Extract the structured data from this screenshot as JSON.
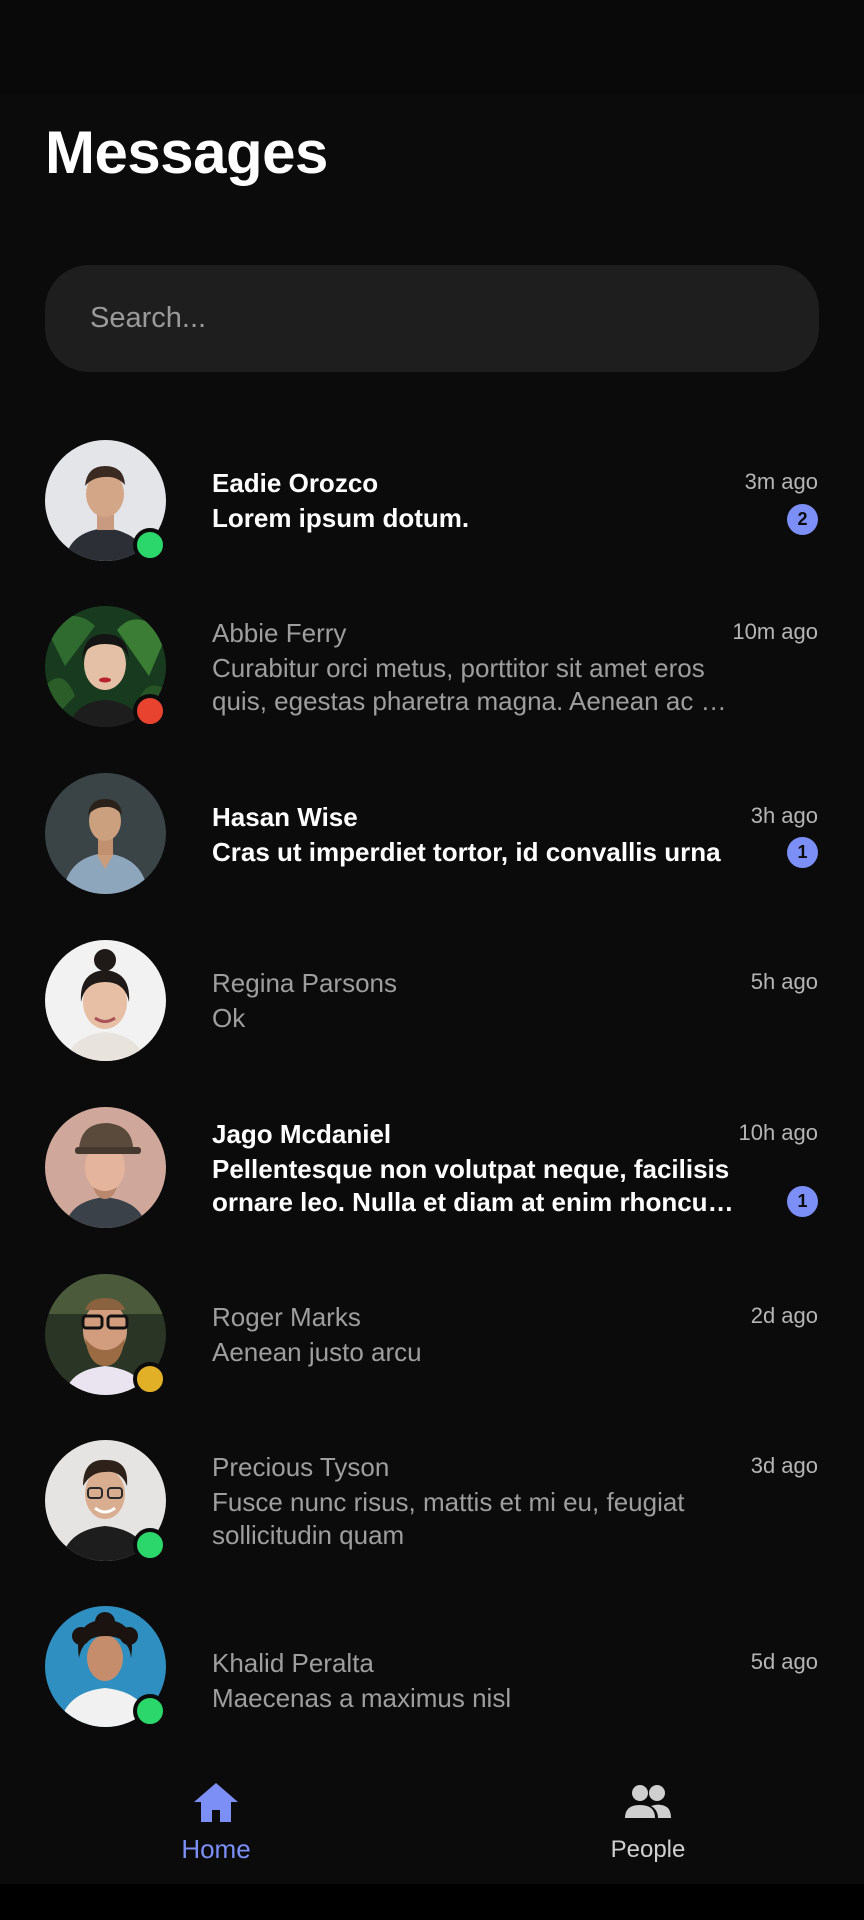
{
  "header": {
    "title": "Messages"
  },
  "search": {
    "placeholder": "Search..."
  },
  "colors": {
    "accent": "#7b8ff7",
    "online": "#2bd66b",
    "busy": "#e8432f",
    "away": "#e2b027",
    "background": "#0b0b0b"
  },
  "conversations": [
    {
      "name": "Eadie Orozco",
      "message": "Lorem ipsum dotum.",
      "time": "3m ago",
      "unread_count": "2",
      "status": "online"
    },
    {
      "name": "Abbie Ferry",
      "message": "Curabitur orci metus, porttitor sit amet eros quis, egestas pharetra magna. Aenean ac mi luctus, …",
      "time": "10m ago",
      "unread_count": null,
      "status": "busy"
    },
    {
      "name": "Hasan Wise",
      "message": "Cras ut imperdiet tortor, id convallis urna",
      "time": "3h ago",
      "unread_count": "1",
      "status": null
    },
    {
      "name": "Regina Parsons",
      "message": "Ok",
      "time": "5h ago",
      "unread_count": null,
      "status": null
    },
    {
      "name": "Jago Mcdaniel",
      "message": "Pellentesque non volutpat neque, facilisis ornare leo. Nulla et diam at enim rhoncus …",
      "time": "10h ago",
      "unread_count": "1",
      "status": null
    },
    {
      "name": "Roger Marks",
      "message": "Aenean justo arcu",
      "time": "2d ago",
      "unread_count": null,
      "status": "away"
    },
    {
      "name": "Precious Tyson",
      "message": "Fusce nunc risus, mattis et mi eu, feugiat sollicitudin quam",
      "time": "3d ago",
      "unread_count": null,
      "status": "online"
    },
    {
      "name": "Khalid Peralta",
      "message": "Maecenas a maximus nisl",
      "time": "5d ago",
      "unread_count": null,
      "status": "online"
    }
  ],
  "bottom_nav": {
    "home": {
      "label": "Home",
      "icon": "home-icon",
      "active": true
    },
    "people": {
      "label": "People",
      "icon": "people-icon",
      "active": false
    }
  }
}
